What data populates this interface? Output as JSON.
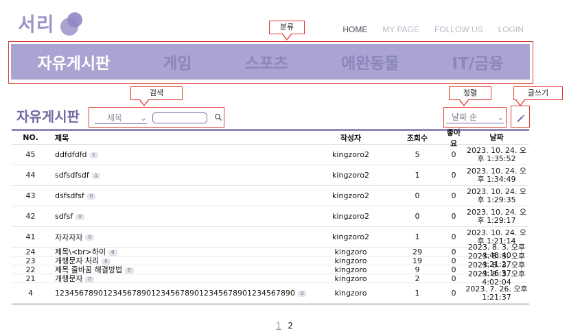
{
  "header": {
    "logo": "서리",
    "nav": [
      "HOME",
      "MY PAGE",
      "FOLLOW US",
      "LOGIN"
    ]
  },
  "annotations": {
    "category": "분류",
    "search": "검색",
    "sort": "정렬",
    "write": "글쓰기"
  },
  "categories": [
    "자유게시판",
    "게임",
    "스포츠",
    "애완동물",
    "IT/금융"
  ],
  "board": {
    "title": "자유게시판",
    "search_field": "제목",
    "sort": "날짜 순"
  },
  "table": {
    "headers": [
      "NO.",
      "제목",
      "작성자",
      "조회수",
      "좋아요",
      "날짜"
    ],
    "rows": [
      {
        "no": "45",
        "title": "ddfdfdfd",
        "comments": "1",
        "author": "kingzoro2",
        "views": "5",
        "likes": "0",
        "date": "2023. 10. 24. 오후 1:35:52"
      },
      {
        "no": "44",
        "title": "sdfsdfsdf",
        "comments": "1",
        "author": "kingzoro2",
        "views": "1",
        "likes": "0",
        "date": "2023. 10. 24. 오후 1:34:49"
      },
      {
        "no": "43",
        "title": "dsfsdfsf",
        "comments": "0",
        "author": "kingzoro2",
        "views": "0",
        "likes": "0",
        "date": "2023. 10. 24. 오후 1:29:35"
      },
      {
        "no": "42",
        "title": "sdfsf",
        "comments": "0",
        "author": "kingzoro2",
        "views": "0",
        "likes": "0",
        "date": "2023. 10. 24. 오후 1:29:17"
      },
      {
        "no": "41",
        "title": "자자자자",
        "comments": "0",
        "author": "kingzoro2",
        "views": "1",
        "likes": "0",
        "date": "2023. 10. 24. 오후 1:21:14"
      },
      {
        "no": "24",
        "title": "제목\\<br>하이",
        "comments": "0",
        "author": "kingzoro",
        "views": "29",
        "likes": "0",
        "date": "2023. 8. 3. 오후 4:48:40"
      },
      {
        "no": "23",
        "title": "개행문자 처리",
        "comments": "0",
        "author": "kingzoro",
        "views": "19",
        "likes": "0",
        "date": "2023. 8. 3. 오후 4:21:27"
      },
      {
        "no": "22",
        "title": "제목 줄바꿈 해결방법",
        "comments": "0",
        "author": "kingzoro",
        "views": "9",
        "likes": "0",
        "date": "2023. 8. 3. 오후 4:16:37"
      },
      {
        "no": "21",
        "title": "개행문자",
        "comments": "0",
        "author": "kingzoro",
        "views": "2",
        "likes": "0",
        "date": "2023. 8. 3. 오후 4:02:04"
      },
      {
        "no": "4",
        "title": "12345678901234567890123456789012345678901234567890",
        "comments": "0",
        "author": "kingzoro",
        "views": "1",
        "likes": "0",
        "date": "2023. 7. 26. 오후 1:21:37"
      }
    ]
  },
  "pagination": [
    "1",
    "2"
  ]
}
